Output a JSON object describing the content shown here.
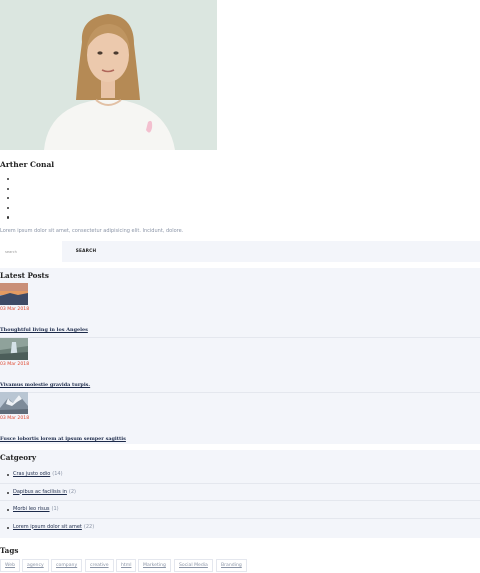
{
  "author": {
    "photo_icon": "woman-portrait-photo",
    "name": "Arther Conal",
    "social_icons": [
      "social-link",
      "social-link",
      "social-link",
      "social-link",
      "social-link"
    ],
    "bio": "Lorem ipsum dolor sit amet, consectetur adipisicing elit. Incidunt, dolore."
  },
  "search": {
    "placeholder": "search",
    "button_label": "SEARCH"
  },
  "latest_posts": {
    "title": "Latest Posts",
    "posts": [
      {
        "thumb_icon": "sunset-landscape-thumbnail",
        "date": "03 Mar 2018",
        "title": "Thoughtful living in los Angeles"
      },
      {
        "thumb_icon": "waterfall-landscape-thumbnail",
        "date": "03 Mar 2018",
        "title": "Vivamus molestie gravida turpis."
      },
      {
        "thumb_icon": "snowy-mountain-thumbnail",
        "date": "03 Mar 2018",
        "title": "Fusce lobortis lorem at ipsum semper sagittis"
      }
    ]
  },
  "categories": {
    "title": "Catgeory",
    "items": [
      {
        "label": "Cras justo odio",
        "count": "(14)"
      },
      {
        "label": "Dapibus ac facilisis in",
        "count": "(2)"
      },
      {
        "label": "Morbi leo risus",
        "count": "(1)"
      },
      {
        "label": "Lorem ipsum dolor sit amet",
        "count": "(22)"
      }
    ]
  },
  "tags": {
    "title": "Tags",
    "items": [
      "Web",
      "agency",
      "company",
      "creative",
      "html",
      "Marketing",
      "Social Media",
      "Branding"
    ]
  },
  "colors": {
    "accent_date": "#e0462d",
    "link": "#1c2a4a",
    "panel_bg": "#f3f5fa",
    "muted_text": "#8a94a6"
  }
}
